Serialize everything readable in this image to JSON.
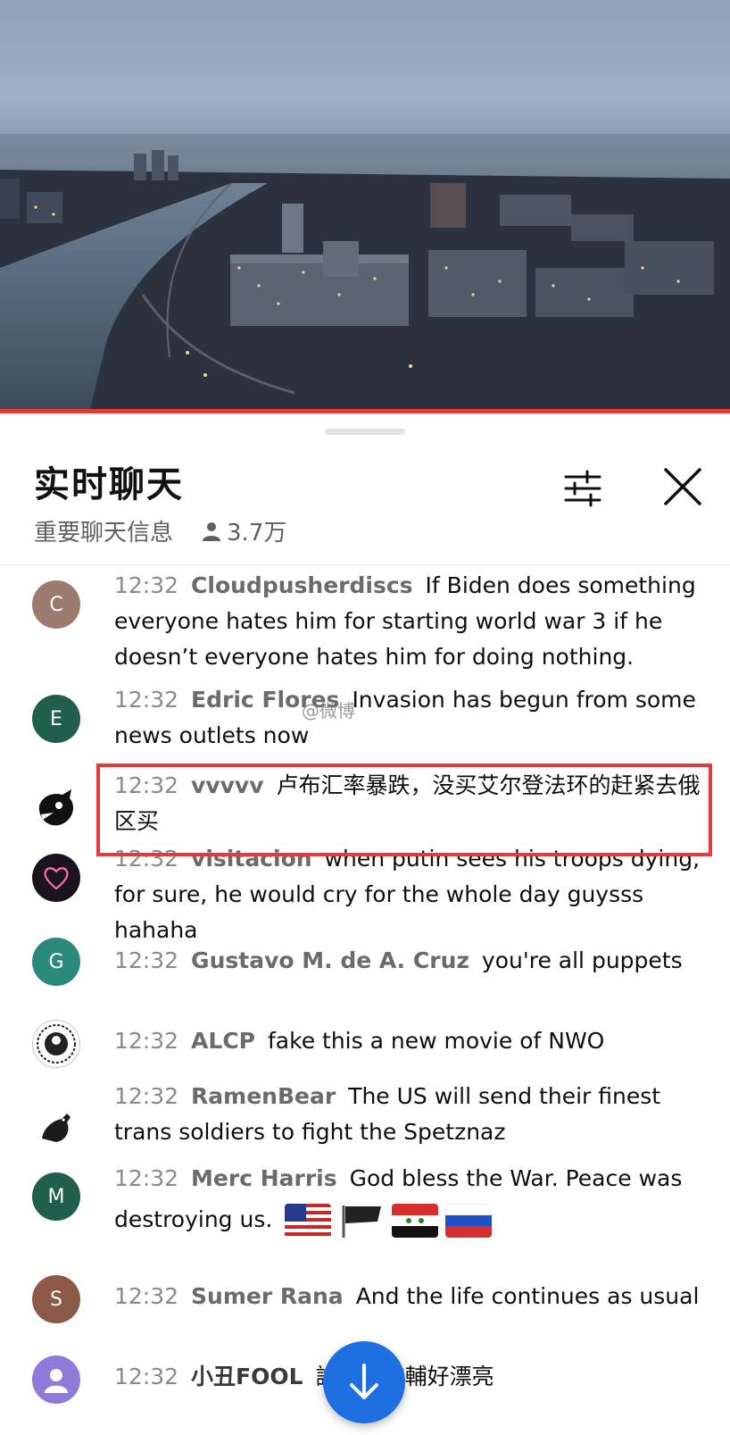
{
  "header": {
    "title": "实时聊天",
    "subtitle": "重要聊天信息",
    "viewer_count": "3.7万"
  },
  "messages": [
    {
      "time": "12:32",
      "author": "Cloudpusherdiscs",
      "text": "If Biden does something everyone hates him for starting world war 3 if he doesn’t everyone hates him for doing nothing.",
      "avatar_letter": "C",
      "avatar_color": "#9b7b6e"
    },
    {
      "time": "12:32",
      "author": "Edric Flores",
      "text": "Invasion has begun from some news outlets now",
      "avatar_letter": "E",
      "avatar_color": "#1f5f4b"
    },
    {
      "time": "12:32",
      "author": "vvvvv",
      "text": "卢布汇率暴跌，没买艾尔登法环的赶紧去俄区买",
      "avatar_letter": "",
      "avatar_color": "#111111"
    },
    {
      "time": "12:32",
      "author": "visitacion",
      "text": "when putin sees his troops dying, for sure, he would cry for the whole day guysss hahaha",
      "avatar_letter": "",
      "avatar_color": "#1a1420"
    },
    {
      "time": "12:32",
      "author": "Gustavo M. de A. Cruz",
      "text": "you're all puppets",
      "avatar_letter": "G",
      "avatar_color": "#2a8a7a"
    },
    {
      "time": "12:32",
      "author": "ALCP",
      "text": "fake this a new movie of NWO",
      "avatar_letter": "",
      "avatar_color": "#ffffff"
    },
    {
      "time": "12:32",
      "author": "RamenBear",
      "text": "The US will send their finest trans soldiers to fight the Spetznaz",
      "avatar_letter": "",
      "avatar_color": "#ffffff"
    },
    {
      "time": "12:32",
      "author": "Merc Harris",
      "text": "God bless the War. Peace was destroying us.",
      "avatar_letter": "M",
      "avatar_color": "#1f5f4b"
    },
    {
      "time": "12:32",
      "author": "Sumer Rana",
      "text": "And the life continues as usual",
      "avatar_letter": "S",
      "avatar_color": "#8d5a4a"
    },
    {
      "time": "12:32",
      "author": "小丑FOOL",
      "text": "說真的这輔好漂亮",
      "avatar_letter": "",
      "avatar_color": "#8e7bd8"
    }
  ],
  "watermark": "@微博",
  "icons": {
    "filter": "filter-sliders-icon",
    "close": "close-icon",
    "viewers": "person-icon",
    "scroll": "arrow-down-icon"
  },
  "colors": {
    "accent": "#e53935",
    "highlight_border": "#e23b3b",
    "scroll_button": "#1e6fe0"
  }
}
